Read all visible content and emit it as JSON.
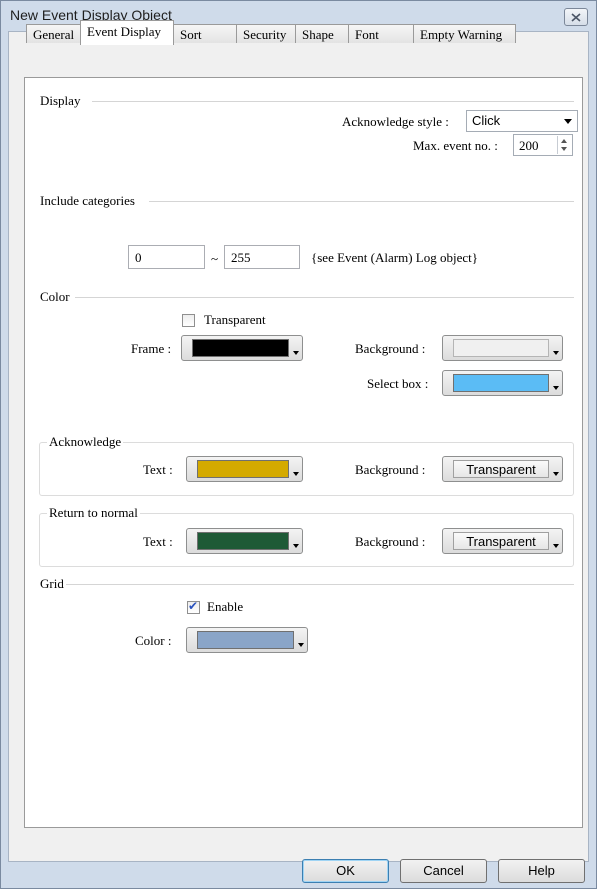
{
  "window": {
    "title": "New Event Display Object"
  },
  "tabs": [
    {
      "label": "General"
    },
    {
      "label": "Event Display"
    },
    {
      "label": "Sort"
    },
    {
      "label": "Security"
    },
    {
      "label": "Shape"
    },
    {
      "label": "Font"
    },
    {
      "label": "Empty Warning"
    }
  ],
  "display": {
    "section_label": "Display",
    "ack_style_label": "Acknowledge style :",
    "ack_style_value": "Click",
    "max_event_label": "Max. event no. :",
    "max_event_value": "200"
  },
  "categories": {
    "section_label": "Include categories",
    "from_value": "0",
    "separator": "~",
    "to_value": "255",
    "note": "{see Event (Alarm) Log object}"
  },
  "color": {
    "section_label": "Color",
    "transparent_label": "Transparent",
    "transparent_checked": false,
    "frame_label": "Frame :",
    "frame_color": "#000000",
    "background_label": "Background :",
    "background_color": "#f0f0f0",
    "select_box_label": "Select box :",
    "select_box_color": "#5bbcf5"
  },
  "acknowledge": {
    "group_label": "Acknowledge",
    "text_label": "Text :",
    "text_color": "#d4aa00",
    "background_label": "Background :",
    "background_value": "Transparent"
  },
  "return_to_normal": {
    "group_label": "Return to normal",
    "text_label": "Text :",
    "text_color": "#1e5a36",
    "background_label": "Background :",
    "background_value": "Transparent"
  },
  "grid": {
    "section_label": "Grid",
    "enable_label": "Enable",
    "enable_checked": true,
    "color_label": "Color :",
    "color_value": "#8aa5c8"
  },
  "buttons": {
    "ok": "OK",
    "cancel": "Cancel",
    "help": "Help"
  }
}
